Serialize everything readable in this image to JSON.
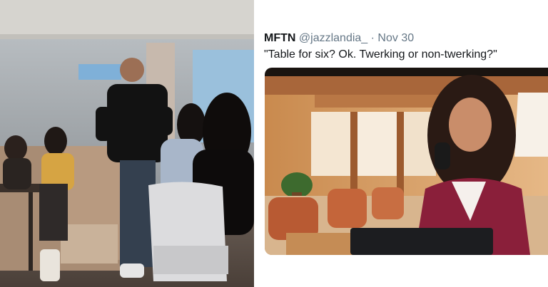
{
  "tweet": {
    "name": "MFTN",
    "handle": "@jazzlandia_",
    "separator": "·",
    "date": "Nov 30",
    "text": "\"Table for six? Ok. Twerking or non-twerking?\""
  }
}
